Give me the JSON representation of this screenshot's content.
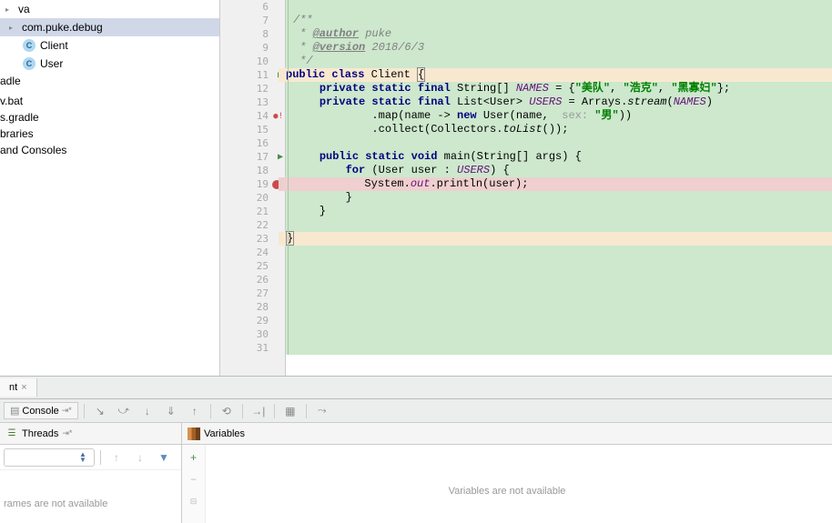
{
  "project_tree": {
    "items": [
      {
        "label": "va",
        "indent": 0,
        "type": "folder"
      },
      {
        "label": "com.puke.debug",
        "indent": 4,
        "type": "folder",
        "selected": true
      },
      {
        "label": "Client",
        "indent": 24,
        "type": "class"
      },
      {
        "label": "User",
        "indent": 24,
        "type": "class"
      },
      {
        "label": "adle",
        "indent": 0,
        "type": "plain"
      },
      {
        "label": "",
        "indent": 0,
        "type": "plain"
      },
      {
        "label": "v.bat",
        "indent": 0,
        "type": "plain"
      },
      {
        "label": "s.gradle",
        "indent": 0,
        "type": "plain"
      },
      {
        "label": "braries",
        "indent": 0,
        "type": "plain"
      },
      {
        "label": "and Consoles",
        "indent": 0,
        "type": "plain"
      }
    ]
  },
  "gutter": {
    "start": 6,
    "end": 31,
    "markers": {
      "11": "run",
      "14": "exc",
      "17": "run",
      "19": "breakpoint"
    }
  },
  "code": {
    "lines": [
      {
        "n": 6,
        "segs": []
      },
      {
        "n": 7,
        "segs": [
          {
            "t": "/**",
            "c": "doc"
          }
        ]
      },
      {
        "n": 8,
        "segs": [
          {
            "t": " * ",
            "c": "doc"
          },
          {
            "t": "@author",
            "c": "doctag"
          },
          {
            "t": " puke",
            "c": "doc"
          }
        ]
      },
      {
        "n": 9,
        "segs": [
          {
            "t": " * ",
            "c": "doc"
          },
          {
            "t": "@version",
            "c": "doctag"
          },
          {
            "t": " 2018/6/3",
            "c": "doc"
          }
        ]
      },
      {
        "n": 10,
        "segs": [
          {
            "t": " */",
            "c": "doc"
          }
        ]
      },
      {
        "n": 11,
        "hl": true,
        "segs": [
          {
            "t": "public class ",
            "c": "kw"
          },
          {
            "t": "Client "
          },
          {
            "t": "{",
            "c": "brace-match"
          }
        ]
      },
      {
        "n": 12,
        "segs": [
          {
            "t": "    "
          },
          {
            "t": "private static final ",
            "c": "kw"
          },
          {
            "t": "String[] "
          },
          {
            "t": "NAMES",
            "c": "static-var"
          },
          {
            "t": " = {"
          },
          {
            "t": "\"美队\"",
            "c": "str"
          },
          {
            "t": ", "
          },
          {
            "t": "\"浩克\"",
            "c": "str"
          },
          {
            "t": ", "
          },
          {
            "t": "\"黑寡妇\"",
            "c": "str"
          },
          {
            "t": "};"
          }
        ]
      },
      {
        "n": 13,
        "segs": [
          {
            "t": "    "
          },
          {
            "t": "private static final ",
            "c": "kw"
          },
          {
            "t": "List<User> "
          },
          {
            "t": "USERS",
            "c": "static-var"
          },
          {
            "t": " = Arrays."
          },
          {
            "t": "stream",
            "c": "static-method"
          },
          {
            "t": "("
          },
          {
            "t": "NAMES",
            "c": "static-var"
          },
          {
            "t": ")"
          }
        ]
      },
      {
        "n": 14,
        "segs": [
          {
            "t": "            .map(name -> "
          },
          {
            "t": "new ",
            "c": "kw"
          },
          {
            "t": "User(name,  "
          },
          {
            "t": "sex: ",
            "c": "param-label"
          },
          {
            "t": "\"男\"",
            "c": "str"
          },
          {
            "t": "))"
          }
        ]
      },
      {
        "n": 15,
        "segs": [
          {
            "t": "            .collect(Collectors."
          },
          {
            "t": "toList",
            "c": "static-method"
          },
          {
            "t": "());"
          }
        ]
      },
      {
        "n": 16,
        "segs": []
      },
      {
        "n": 17,
        "segs": [
          {
            "t": "    "
          },
          {
            "t": "public static void ",
            "c": "kw"
          },
          {
            "t": "main(String[] args) {"
          }
        ]
      },
      {
        "n": 18,
        "segs": [
          {
            "t": "        "
          },
          {
            "t": "for ",
            "c": "kw"
          },
          {
            "t": "(User user : "
          },
          {
            "t": "USERS",
            "c": "static-var"
          },
          {
            "t": ") {"
          }
        ]
      },
      {
        "n": 19,
        "bp": true,
        "segs": [
          {
            "t": "            System."
          },
          {
            "t": "out",
            "c": "static-var"
          },
          {
            "t": ".println(user);"
          }
        ]
      },
      {
        "n": 20,
        "segs": [
          {
            "t": "        }"
          }
        ]
      },
      {
        "n": 21,
        "segs": [
          {
            "t": "    }"
          }
        ]
      },
      {
        "n": 22,
        "segs": []
      },
      {
        "n": 23,
        "hl": true,
        "segs": [
          {
            "t": "}",
            "c": "brace-match"
          }
        ]
      },
      {
        "n": 24,
        "segs": []
      },
      {
        "n": 25,
        "segs": []
      },
      {
        "n": 26,
        "segs": []
      },
      {
        "n": 27,
        "segs": []
      },
      {
        "n": 28,
        "segs": []
      },
      {
        "n": 29,
        "segs": []
      },
      {
        "n": 30,
        "segs": []
      },
      {
        "n": 31,
        "segs": []
      }
    ]
  },
  "bottom_tab": "nt",
  "console_tab": "Console",
  "threads_tab": "Threads",
  "variables_tab": "Variables",
  "frames_empty": "rames are not available",
  "vars_empty": "Variables are not available",
  "pin_icon": "⇥*"
}
